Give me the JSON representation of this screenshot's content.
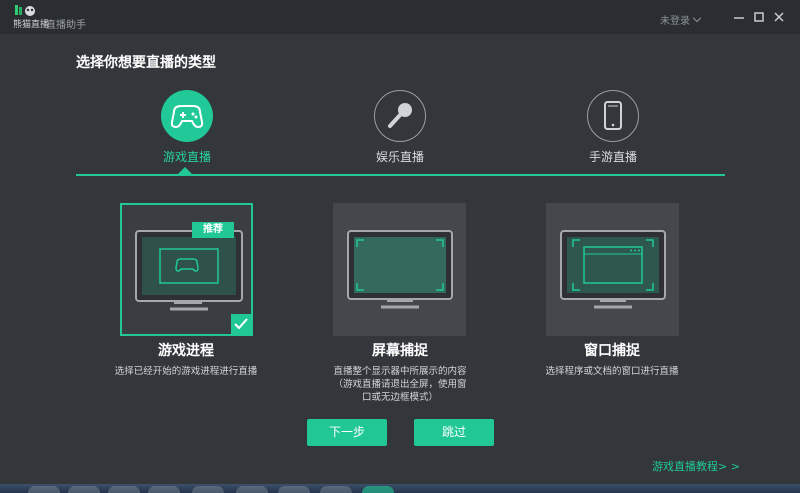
{
  "window": {
    "logo_text": "熊猫直播",
    "app_subtitle": "直播助手",
    "login_label": "未登录"
  },
  "heading": "选择你想要直播的类型",
  "categories": [
    {
      "label": "游戏直播",
      "icon": "gamepad-icon",
      "active": true
    },
    {
      "label": "娱乐直播",
      "icon": "microphone-icon",
      "active": false
    },
    {
      "label": "手游直播",
      "icon": "phone-icon",
      "active": false
    }
  ],
  "modes": [
    {
      "title": "游戏进程",
      "badge": "推荐",
      "selected": true,
      "description": [
        "选择已经开始的游戏进程进行直播"
      ]
    },
    {
      "title": "屏幕捕捉",
      "selected": false,
      "description": [
        "直播整个显示器中所展示的内容",
        "（游戏直播请退出全屏，使用窗",
        "口或无边框模式）"
      ]
    },
    {
      "title": "窗口捕捉",
      "selected": false,
      "description": [
        "选择程序或文档的窗口进行直播"
      ]
    }
  ],
  "buttons": {
    "next": "下一步",
    "skip": "跳过"
  },
  "tutorial_link": "游戏直播教程> >",
  "colors": {
    "accent": "#21c896",
    "background": "#33363b",
    "titlebar": "#2a2d31"
  }
}
